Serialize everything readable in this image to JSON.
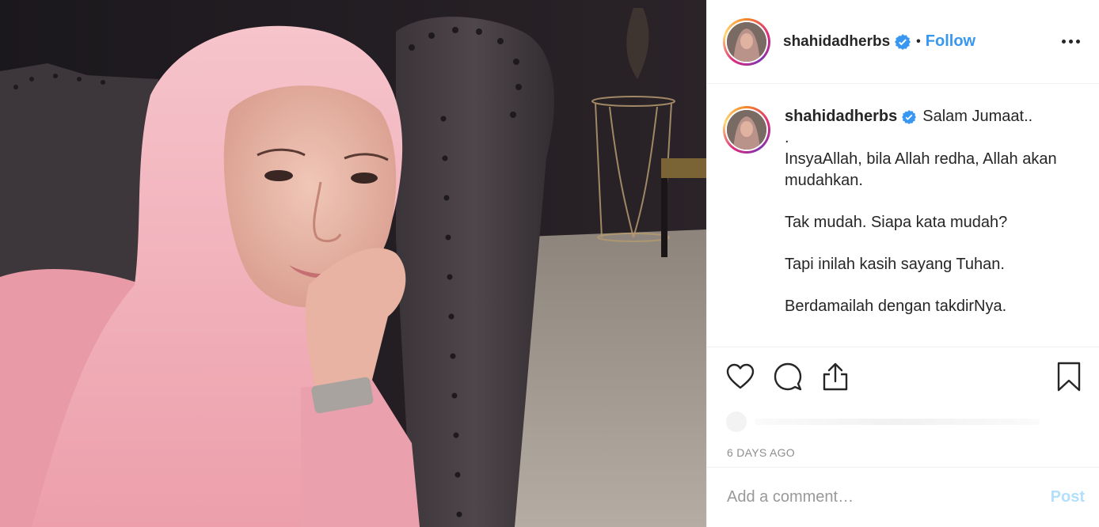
{
  "post": {
    "username": "shahidadherbs",
    "follow_label": "Follow",
    "separator": "•",
    "caption_lines": [
      "Salam Jumaat..",
      ".",
      "InsyaAllah, bila Allah redha, Allah akan",
      "mudahkan.",
      "",
      "Tak mudah. Siapa kata mudah?",
      "",
      "Tapi inilah kasih sayang Tuhan.",
      "",
      "Berdamailah dengan takdirNya."
    ],
    "timestamp": "6 DAYS AGO",
    "comment_placeholder": "Add a comment…",
    "post_label": "Post"
  },
  "icons": {
    "verified": "verified-badge-icon",
    "more": "more-options-icon",
    "like": "heart-icon",
    "comment": "comment-bubble-icon",
    "share": "share-icon",
    "save": "bookmark-icon"
  },
  "colors": {
    "accent": "#3897f0",
    "post_disabled": "#b2dffc",
    "muted": "#8e8e8e",
    "border": "#efefef",
    "hijab_pink": "#f2b3bd"
  }
}
